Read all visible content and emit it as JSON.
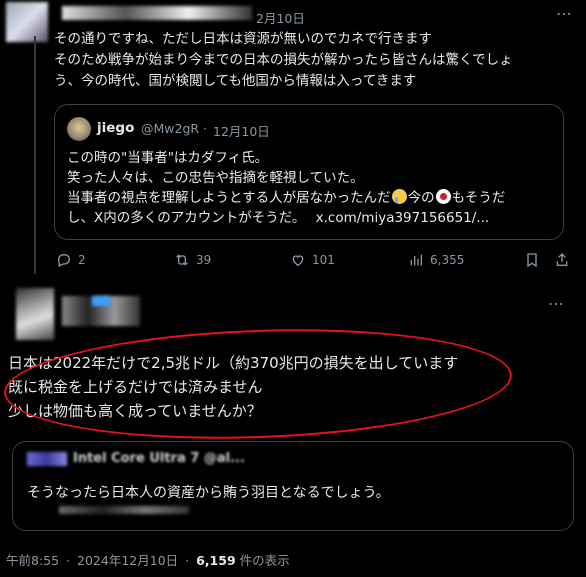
{
  "reply_tweet": {
    "date": "2月10日",
    "lines": [
      "その通りですね、ただし日本は資源が無いのでカネで行きます",
      "そのため戦争が始まり今までの日本の損失が解かったら皆さんは驚くでしょう、今の時代、国が検閲しても他国から情報は入ってきます"
    ],
    "line2a": "そのため戦争が始まり今までの日本の損失が解かったら皆さんは驚くでしょ",
    "line2b": "う、今の時代、国が検閲しても他国から情報は入ってきます"
  },
  "quoted": {
    "name": "jiego",
    "handle": "@Mw2gR",
    "date": "12月10日",
    "line1": "この時の\"当事者\"はカダフィ氏。",
    "line2": "笑った人々は、この忠告や指摘を軽視していた。",
    "line3a": "当事者の視点を理解しようとする人が居なかったんだ",
    "line3b": "今の",
    "line3c": "もそうだ",
    "line4a": "し、X内の多くのアカウントがそうだ。",
    "line4b": "x.com/miya397156651/..."
  },
  "actions": {
    "replies": "2",
    "retweets": "39",
    "likes": "101",
    "views": "6,355"
  },
  "main_tweet": {
    "line1": "日本は2022年だけで2,5兆ドル（約370兆円の損失を出しています",
    "line2": "既に税金を上げるだけでは済みません",
    "line3": "少しは物価も高く成っていませんか？"
  },
  "quote2": {
    "header": "Intel Core Ultra 7 @al...",
    "text": "そうなったら日本人の資産から賄う羽目となるでしょう。"
  },
  "footer": {
    "time": "午前8:55",
    "sep": "·",
    "date": "2024年12月10日",
    "views_count": "6,159",
    "views_label": "件の表示"
  },
  "colors": {
    "background": "#000000",
    "text": "#e7e9ea",
    "muted": "#8b98a5",
    "link": "#e7e9ea",
    "highlight": "#e3121b"
  }
}
